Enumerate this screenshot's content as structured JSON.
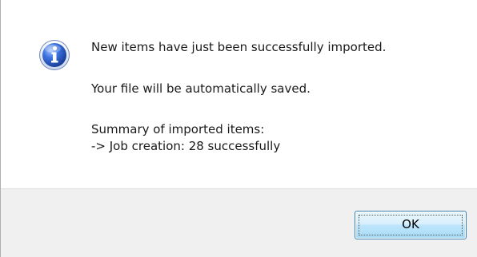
{
  "dialog": {
    "icon": "info-icon",
    "messages": {
      "line1": "New items have just been successfully imported.",
      "line2": "Your file will be automatically saved.",
      "line3": "Summary of imported items:",
      "line4": "-> Job creation: 28 successfully"
    },
    "ok_label": "OK"
  },
  "colors": {
    "icon_blue": "#2a5fc8",
    "footer_bg": "#f0f0f0",
    "button_border": "#3c7fb1"
  }
}
